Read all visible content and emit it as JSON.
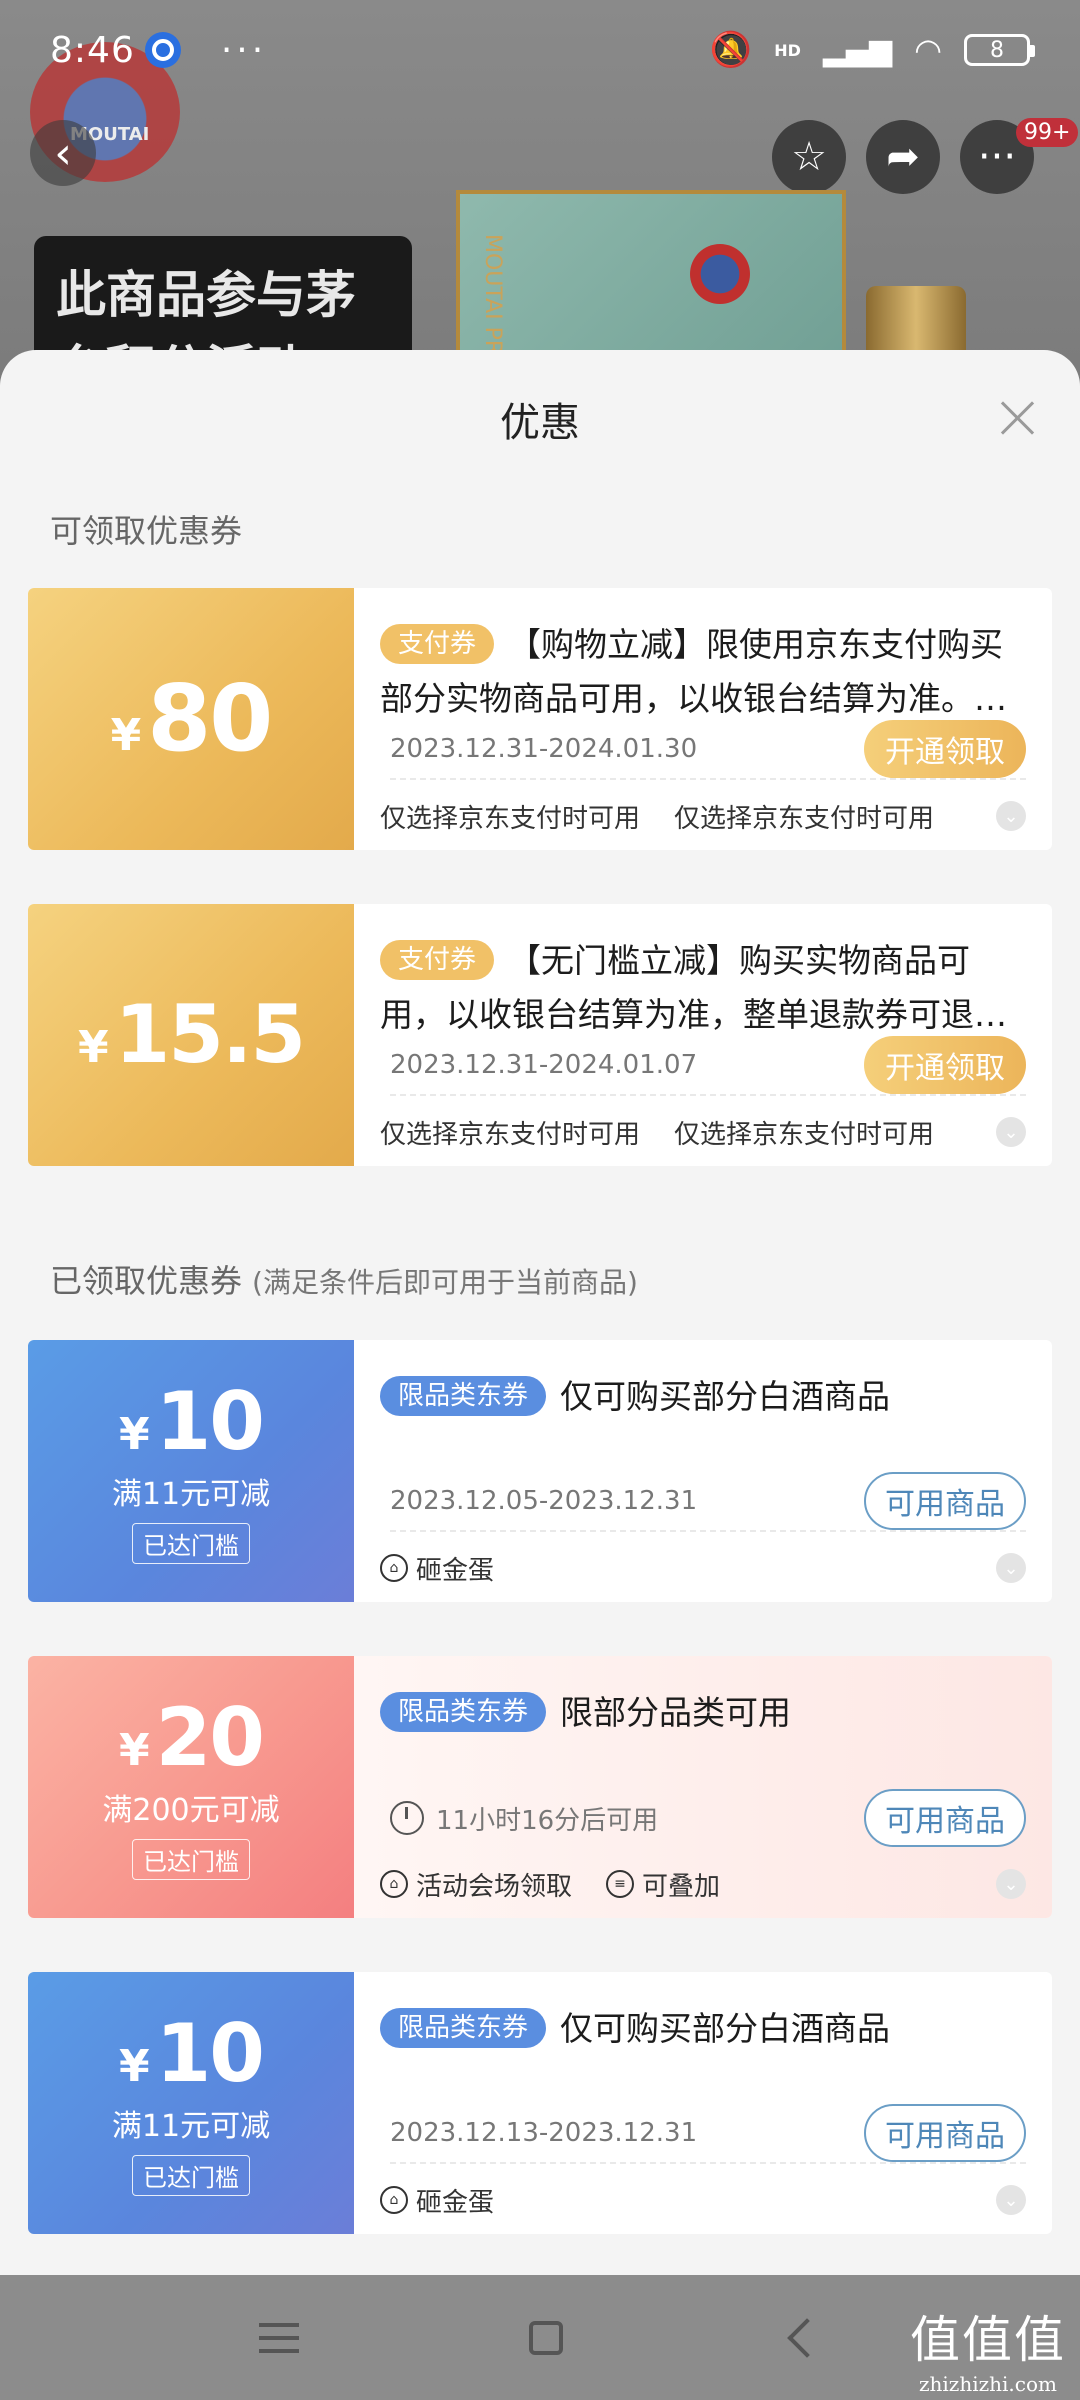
{
  "status_bar": {
    "time": "8:46",
    "dots": "···",
    "hd": "HD",
    "battery": "8"
  },
  "background": {
    "logo_text": "MOUTAI",
    "banner_text": "此商品参与茅台积分活动",
    "badge": "99+",
    "box_text": "MOUTAI PRINCE"
  },
  "sheet": {
    "title": "优惠",
    "available_section": "可领取优惠券",
    "claimed_section": "已领取优惠券",
    "claimed_note": "(满足条件后即可用于当前商品)"
  },
  "available_coupons": [
    {
      "currency": "¥",
      "amount": "80",
      "tag": "支付券",
      "desc": "【购物立减】限使用京东支付购买部分实物商品可用，以收银台结算为准。…",
      "date": "2023.12.31-2024.01.30",
      "button": "开通领取",
      "foot_1": "仅选择京东支付时可用",
      "foot_2": "仅选择京东支付时可用"
    },
    {
      "currency": "¥",
      "amount": "15.5",
      "tag": "支付券",
      "desc": "【无门槛立减】购买实物商品可用，以收银台结算为准，整单退款券可退…",
      "date": "2023.12.31-2024.01.07",
      "button": "开通领取",
      "foot_1": "仅选择京东支付时可用",
      "foot_2": "仅选择京东支付时可用"
    }
  ],
  "claimed_coupons": [
    {
      "currency": "¥",
      "amount": "10",
      "condition": "满11元可减",
      "reached": "已达门槛",
      "tag": "限品类东券",
      "desc": "仅可购买部分白酒商品",
      "date": "2023.12.05-2023.12.31",
      "button": "可用商品",
      "foot_1": "砸金蛋"
    },
    {
      "currency": "¥",
      "amount": "20",
      "condition": "满200元可减",
      "reached": "已达门槛",
      "tag": "限品类东券",
      "desc": "限部分品类可用",
      "timer": "11小时16分后可用",
      "button": "可用商品",
      "foot_1": "活动会场领取",
      "foot_2": "可叠加"
    },
    {
      "currency": "¥",
      "amount": "10",
      "condition": "满11元可减",
      "reached": "已达门槛",
      "tag": "限品类东券",
      "desc": "仅可购买部分白酒商品",
      "date": "2023.12.13-2023.12.31",
      "button": "可用商品",
      "foot_1": "砸金蛋"
    }
  ],
  "watermark": {
    "big": "值值值",
    "small": "zhizhizhi.com"
  },
  "colors": {
    "gold": "#ecb95a",
    "blue": "#5a8ee0",
    "pink": "#f89a90",
    "outline_button": "#4e87b8"
  }
}
